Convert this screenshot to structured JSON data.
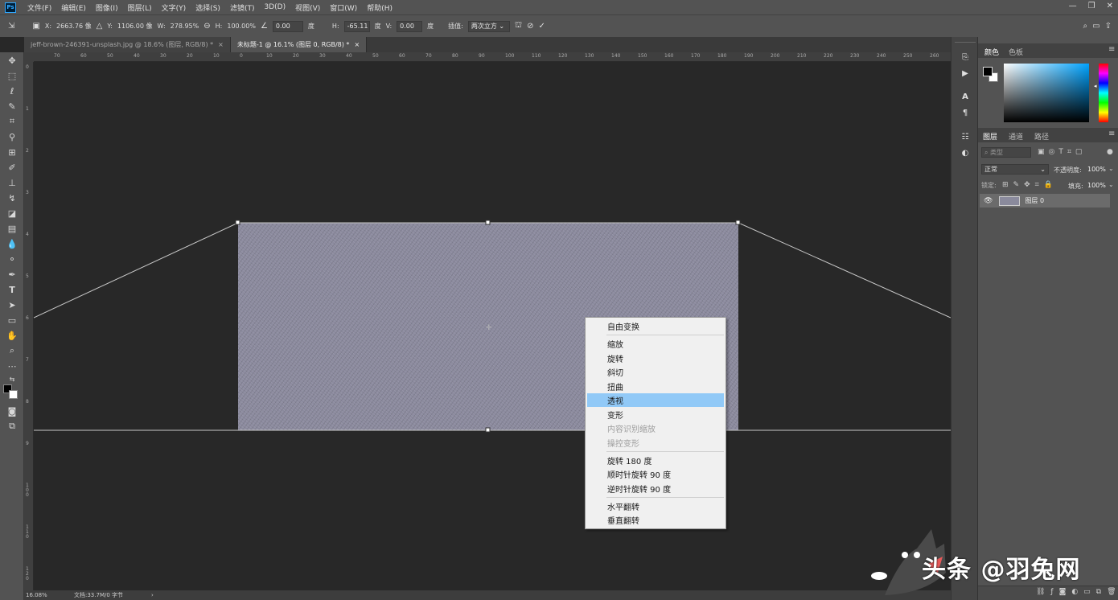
{
  "app": {
    "logo": "Ps"
  },
  "menubar": {
    "items": [
      "文件(F)",
      "编辑(E)",
      "图像(I)",
      "图层(L)",
      "文字(Y)",
      "选择(S)",
      "滤镜(T)",
      "3D(D)",
      "视图(V)",
      "窗口(W)",
      "帮助(H)"
    ],
    "window_controls": [
      "—",
      "❐",
      "✕"
    ]
  },
  "options_bar": {
    "x_label": "X:",
    "x_value": "2663.76 像",
    "y_label": "Y:",
    "y_value": "1106.00 像",
    "w_label": "W:",
    "w_value": "278.95%",
    "h_label": "H:",
    "h_value": "100.00%",
    "angle_value": "0.00",
    "angle_unit": "度",
    "hskew_label": "H:",
    "hskew_value": "-65.11",
    "hskew_unit": "度",
    "vskew_label": "V:",
    "vskew_value": "0.00",
    "vskew_unit": "度",
    "interp_label": "插值:",
    "interp_value": "两次立方"
  },
  "tabs": [
    {
      "label": "jeff-brown-246391-unsplash.jpg @ 18.6% (图层, RGB/8) *",
      "close": "×"
    },
    {
      "label": "未标题-1 @ 16.1% (图层 0, RGB/8) *",
      "close": "×"
    }
  ],
  "ruler_top": [
    "70",
    "60",
    "50",
    "40",
    "30",
    "20",
    "10",
    "0",
    "10",
    "20",
    "30",
    "40",
    "50",
    "60",
    "70",
    "80",
    "90",
    "100",
    "110",
    "120",
    "130",
    "140",
    "150",
    "160",
    "170",
    "180",
    "190",
    "200",
    "210",
    "220",
    "230",
    "240",
    "250",
    "260"
  ],
  "ruler_left": [
    "0",
    "1",
    "2",
    "3",
    "4",
    "5",
    "6",
    "7",
    "8",
    "9",
    "1 0 0",
    "1 1 0",
    "1 2 0"
  ],
  "context_menu": {
    "items": [
      {
        "label": "自由变换",
        "state": "normal"
      },
      {
        "label": "缩放",
        "state": "normal"
      },
      {
        "label": "旋转",
        "state": "normal"
      },
      {
        "label": "斜切",
        "state": "normal"
      },
      {
        "label": "扭曲",
        "state": "normal"
      },
      {
        "label": "透视",
        "state": "highlighted"
      },
      {
        "label": "变形",
        "state": "normal"
      },
      {
        "label": "内容识别缩放",
        "state": "disabled"
      },
      {
        "label": "操控变形",
        "state": "disabled"
      },
      {
        "label": "旋转 180 度",
        "state": "normal"
      },
      {
        "label": "顺时针旋转 90 度",
        "state": "normal"
      },
      {
        "label": "逆时针旋转 90 度",
        "state": "normal"
      },
      {
        "label": "水平翻转",
        "state": "normal"
      },
      {
        "label": "垂直翻转",
        "state": "normal"
      }
    ]
  },
  "status": {
    "zoom": "16.08%",
    "doc": "文档:33.7M/0 字节",
    "arrow": "›"
  },
  "color_panel": {
    "tabs": [
      "颜色",
      "色板"
    ],
    "foreground": "#000000",
    "background": "#ffffff"
  },
  "layers_panel": {
    "tabs": [
      "图层",
      "通道",
      "路径"
    ],
    "search_placeholder": "类型",
    "blend_mode": "正常",
    "opacity_label": "不透明度:",
    "opacity_value": "100%",
    "lock_label": "锁定:",
    "fill_label": "填充:",
    "fill_value": "100%",
    "layers": [
      {
        "name": "图层 0",
        "visible": true
      }
    ]
  },
  "watermark": {
    "text": "头条 @羽兔网"
  }
}
